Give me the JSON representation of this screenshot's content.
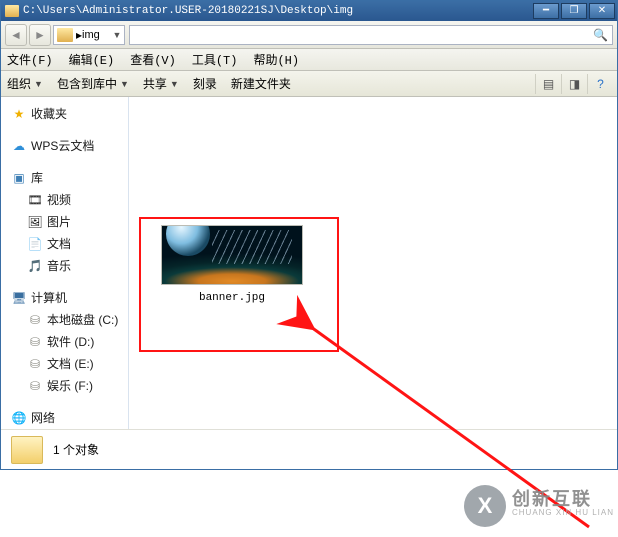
{
  "titlebar": {
    "path": "C:\\Users\\Administrator.USER-20180221SJ\\Desktop\\img"
  },
  "addressbar": {
    "crumb": "img"
  },
  "menubar": {
    "file": "文件(F)",
    "edit": "编辑(E)",
    "view": "查看(V)",
    "tools": "工具(T)",
    "help": "帮助(H)"
  },
  "toolbar": {
    "organize": "组织",
    "include": "包含到库中",
    "share": "共享",
    "burn": "刻录",
    "newfolder": "新建文件夹"
  },
  "sidebar": {
    "favorites": "收藏夹",
    "wps": "WPS云文档",
    "library": "库",
    "lib_items": [
      "视频",
      "图片",
      "文档",
      "音乐"
    ],
    "computer": "计算机",
    "drives": [
      "本地磁盘 (C:)",
      "软件 (D:)",
      "文档 (E:)",
      "娱乐 (F:)"
    ],
    "network": "网络"
  },
  "content": {
    "file_label": "banner.jpg"
  },
  "status": {
    "text": "1 个对象"
  },
  "watermark": {
    "logo_letter": "X",
    "cn": "创新互联",
    "en": "CHUANG XIN HU LIAN"
  }
}
